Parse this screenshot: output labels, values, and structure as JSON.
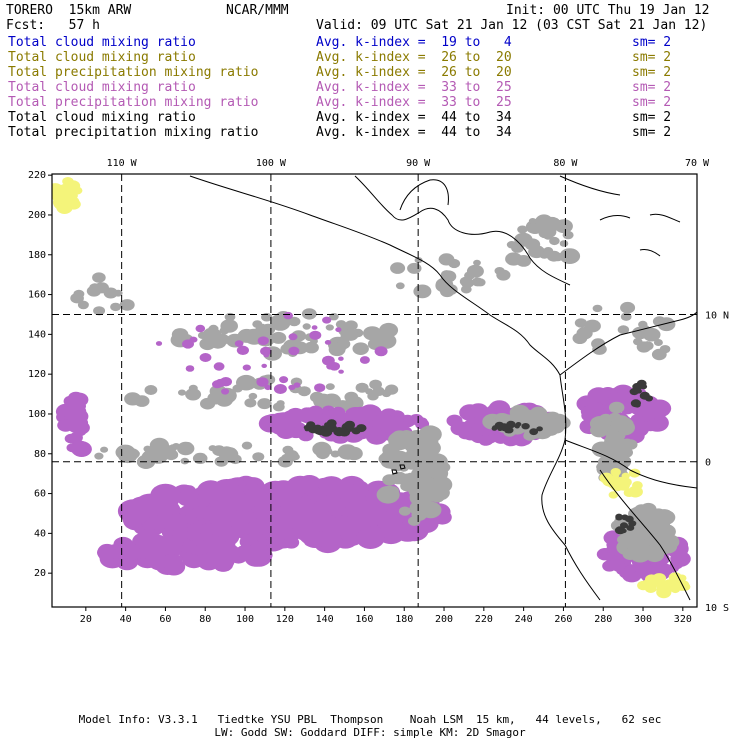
{
  "header": {
    "model": "TORERO  15km ARW",
    "org": "NCAR/MMM",
    "init": "Init: 00 UTC Thu 19 Jan 12",
    "fcst": "Fcst:   57 h",
    "valid": "Valid: 09 UTC Sat 21 Jan 12 (03 CST Sat 21 Jan 12)"
  },
  "legend": [
    {
      "name": "Total cloud mixing ratio",
      "kindex": "Avg. k-index =  19 to   4",
      "sm": "sm= 2",
      "color": "#0000c8"
    },
    {
      "name": "Total cloud mixing ratio",
      "kindex": "Avg. k-index =  26 to  20",
      "sm": "sm= 2",
      "color": "#8a7a00"
    },
    {
      "name": "Total precipitation mixing ratio",
      "kindex": "Avg. k-index =  26 to  20",
      "sm": "sm= 2",
      "color": "#8a7a00"
    },
    {
      "name": "Total cloud mixing ratio",
      "kindex": "Avg. k-index =  33 to  25",
      "sm": "sm= 2",
      "color": "#b45ab4"
    },
    {
      "name": "Total precipitation mixing ratio",
      "kindex": "Avg. k-index =  33 to  25",
      "sm": "sm= 2",
      "color": "#b45ab4"
    },
    {
      "name": "Total cloud mixing ratio",
      "kindex": "Avg. k-index =  44 to  34",
      "sm": "sm= 2",
      "color": "#000000"
    },
    {
      "name": "Total precipitation mixing ratio",
      "kindex": "Avg. k-index =  44 to  34",
      "sm": "sm= 2",
      "color": "#000000"
    }
  ],
  "map": {
    "grid_x_ticks": [
      "20",
      "40",
      "60",
      "80",
      "100",
      "120",
      "140",
      "160",
      "180",
      "200",
      "220",
      "240",
      "260",
      "280",
      "300",
      "320"
    ],
    "grid_y_ticks": [
      "20",
      "40",
      "60",
      "80",
      "100",
      "120",
      "140",
      "160",
      "180",
      "200",
      "220"
    ],
    "lon_labels": [
      "110 W",
      "100 W",
      "90 W",
      "80 W",
      "70 W"
    ],
    "lat_labels": [
      "10 N",
      "0",
      "10 S"
    ],
    "colors": {
      "gray": "#a6a6a6",
      "dark": "#3a3a3a",
      "purple": "#b464c8",
      "yellow": "#f4f47a",
      "coast": "#000000"
    }
  },
  "footer": {
    "line1": "Model Info: V3.3.1   Tiedtke YSU PBL  Thompson    Noah LSM  15 km,   44 levels,   62 sec",
    "line2": "LW: Godd SW: Goddard DIFF: simple KM: 2D Smagor"
  }
}
